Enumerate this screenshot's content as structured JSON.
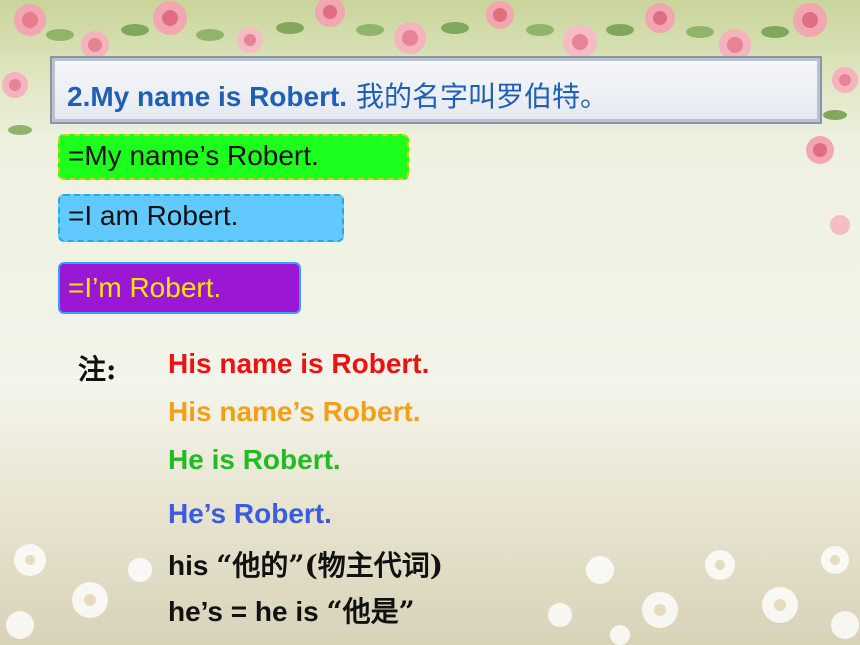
{
  "title": {
    "text": "2.My name is Robert.",
    "chinese": " 我的名字叫罗伯特。"
  },
  "pills": [
    {
      "text": "=My name’s Robert."
    },
    {
      "text": "=I am Robert."
    },
    {
      "text": "=I’m Robert."
    }
  ],
  "note": {
    "label": "注:",
    "lines": [
      {
        "text": "His name is Robert."
      },
      {
        "text": "His name’s Robert."
      },
      {
        "text": "He is Robert."
      },
      {
        "text": "He’s Robert."
      },
      {
        "text": "his",
        "chinese": "“他的”(物主代词)"
      },
      {
        "text": "he’s = he is",
        "chinese": "“他是”"
      }
    ]
  },
  "colors": {
    "title": "#1f5fb4",
    "pill1": "#1dff1d",
    "pill2": "#62c9ff",
    "pill3": "#9a18d3",
    "pill3_text": "#ffe600",
    "line_red": "#ee1111",
    "line_orange": "#f2a01a",
    "line_green": "#22bb22",
    "line_blue": "#3a5de0"
  }
}
